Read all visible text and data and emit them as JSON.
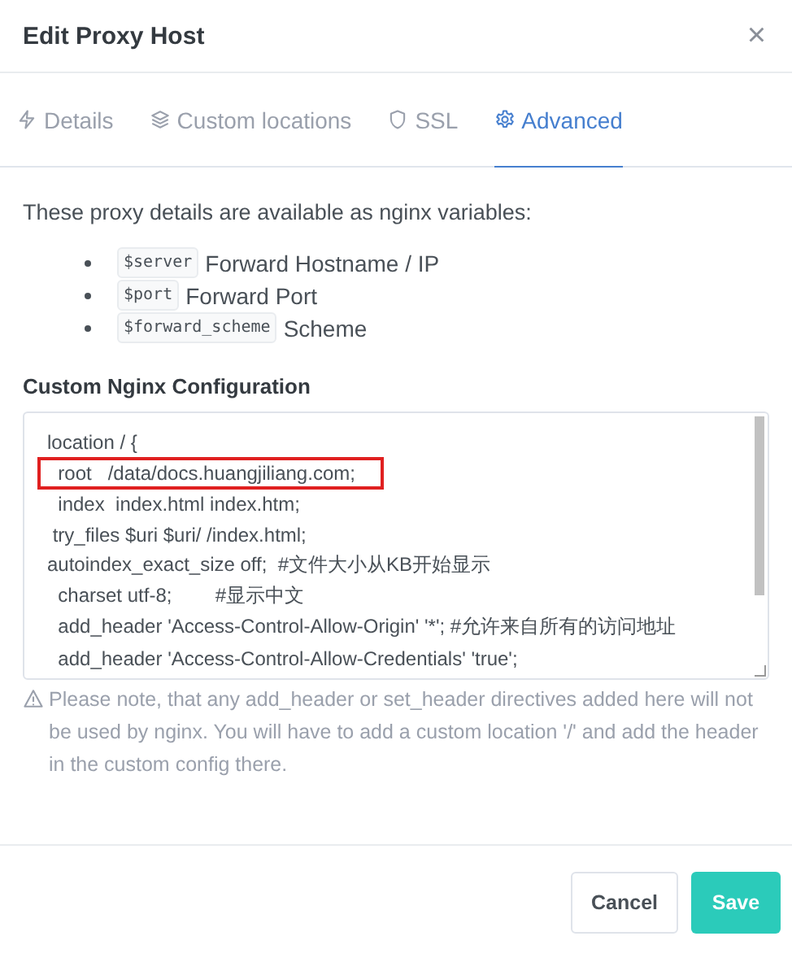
{
  "dialog": {
    "title": "Edit Proxy Host",
    "close": "×"
  },
  "tabs": [
    {
      "label": "Details",
      "kind": "details",
      "selected": false
    },
    {
      "label": "Custom locations",
      "kind": "locations",
      "selected": false
    },
    {
      "label": "SSL",
      "kind": "ssl",
      "selected": false
    },
    {
      "label": "Advanced",
      "kind": "advanced",
      "selected": true
    }
  ],
  "intro": "These proxy details are available as nginx variables:",
  "variables": [
    {
      "code": "$server",
      "description": "Forward Hostname / IP"
    },
    {
      "code": "$port",
      "description": "Forward Port"
    },
    {
      "code": "$forward_scheme",
      "description": "Scheme"
    }
  ],
  "config_label": "Custom Nginx Configuration",
  "config_lines": [
    {
      "text": "location / {",
      "highlighted": false
    },
    {
      "text": "  root   /data/docs.huangjiliang.com;",
      "highlighted": true
    },
    {
      "text": "  index  index.html index.htm;",
      "highlighted": false
    },
    {
      "text": " try_files $uri $uri/ /index.html;",
      "highlighted": false
    },
    {
      "text": "autoindex_exact_size off;  #文件大小从KB开始显示",
      "highlighted": false
    },
    {
      "text": "  charset utf-8;        #显示中文",
      "highlighted": false
    },
    {
      "text": "  add_header 'Access-Control-Allow-Origin' '*'; #允许来自所有的访问地址",
      "highlighted": false
    },
    {
      "text": "  add_header 'Access-Control-Allow-Credentials' 'true';",
      "highlighted": false
    }
  ],
  "warning": "Please note, that any add_header or set_header directives added here will not be used by nginx. You will have to add a custom location '/' and add the header in the custom config there.",
  "buttons": [
    {
      "label": "Cancel",
      "kind": "secondary"
    },
    {
      "label": "Save",
      "kind": "primary"
    }
  ]
}
